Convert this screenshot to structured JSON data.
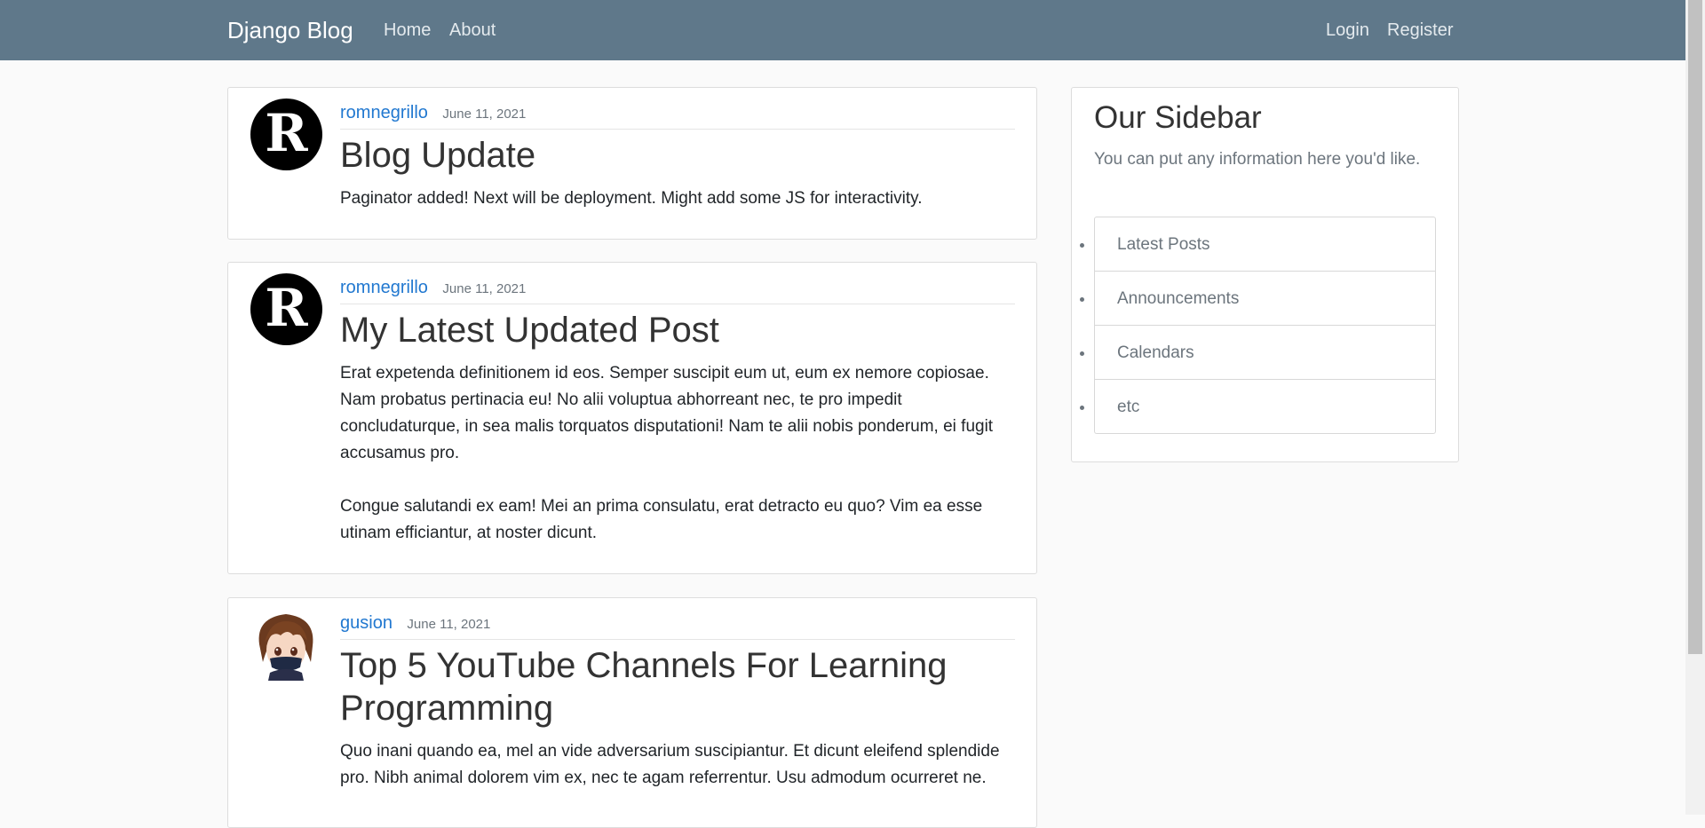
{
  "navbar": {
    "brand": "Django Blog",
    "links": [
      "Home",
      "About"
    ],
    "auth_links": [
      "Login",
      "Register"
    ],
    "bg_color": "#5f788a"
  },
  "posts": [
    {
      "author": "romnegrillo",
      "date": "June 11, 2021",
      "title": "Blog Update",
      "avatar_icon": "letter-r-avatar-icon",
      "avatar_letter": "R",
      "paragraphs": [
        "Paginator added! Next will be deployment. Might add some JS for interactivity."
      ]
    },
    {
      "author": "romnegrillo",
      "date": "June 11, 2021",
      "title": "My Latest Updated Post",
      "avatar_icon": "letter-r-avatar-icon",
      "avatar_letter": "R",
      "paragraphs": [
        "Erat expetenda definitionem id eos. Semper suscipit eum ut, eum ex nemore copiosae. Nam probatus pertinacia eu! No alii voluptua abhorreant nec, te pro impedit concludaturque, in sea malis torquatos disputationi! Nam te alii nobis ponderum, ei fugit accusamus pro.",
        "Congue salutandi ex eam! Mei an prima consulatu, erat detracto eu quo? Vim ea esse utinam efficiantur, at noster dicunt."
      ]
    },
    {
      "author": "gusion",
      "date": "June 11, 2021",
      "title": "Top 5 YouTube Channels For Learning Programming",
      "avatar_icon": "anime-character-avatar-icon",
      "paragraphs": [
        "Quo inani quando ea, mel an vide adversarium suscipiantur. Et dicunt eleifend splendide pro. Nibh animal dolorem vim ex, nec te agam referrentur. Usu admodum ocurreret ne."
      ]
    }
  ],
  "sidebar": {
    "title": "Our Sidebar",
    "description": "You can put any information here you'd like.",
    "items": [
      "Latest Posts",
      "Announcements",
      "Calendars",
      "etc"
    ]
  },
  "colors": {
    "link": "#2178d0",
    "muted": "#6c757d",
    "page_bg": "#fafafa"
  }
}
